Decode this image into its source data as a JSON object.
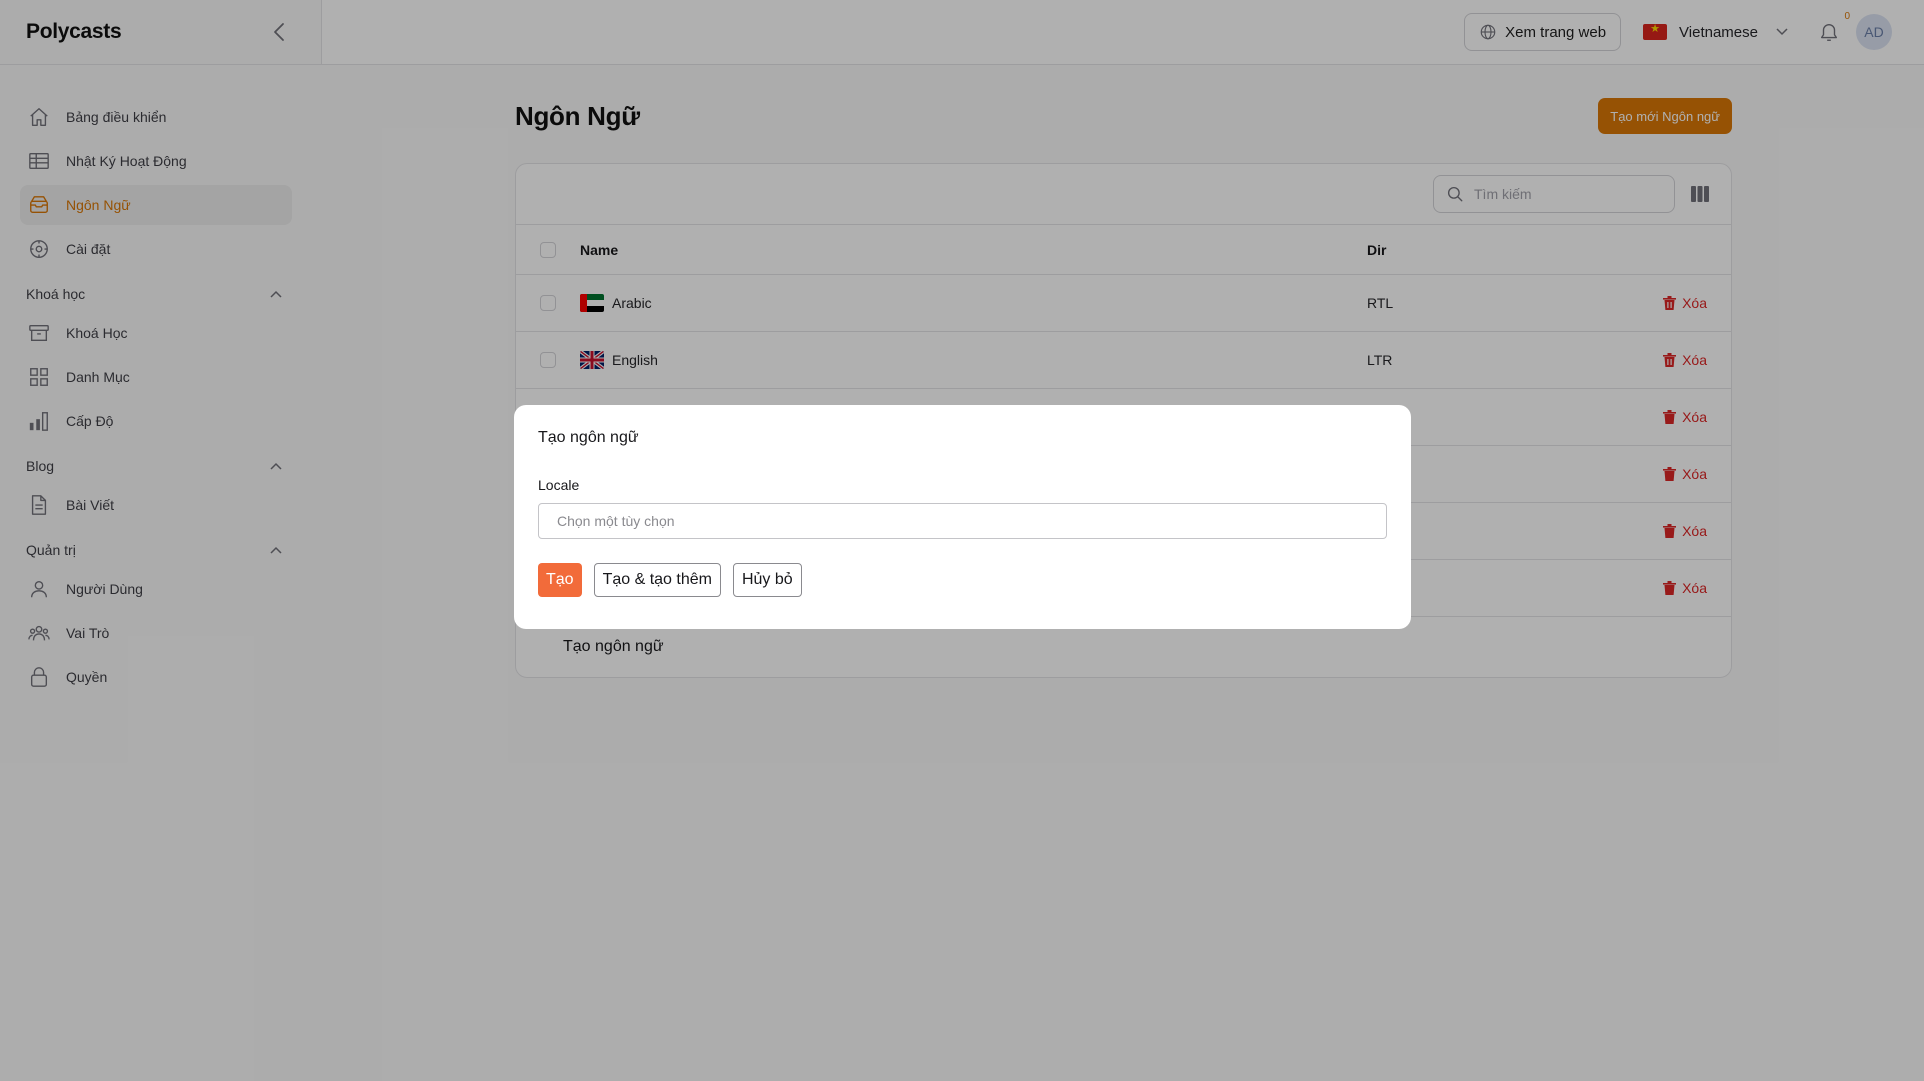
{
  "app": {
    "brand": "Polycasts"
  },
  "topbar": {
    "view_site_label": "Xem trang web",
    "language_label": "Vietnamese",
    "notification_count": "0",
    "avatar_initials": "AD"
  },
  "sidebar": {
    "items": [
      {
        "label": "Bảng điều khiển",
        "icon": "home-icon"
      },
      {
        "label": "Nhật Ký Hoạt Động",
        "icon": "table-icon"
      },
      {
        "label": "Ngôn Ngữ",
        "icon": "inbox-icon",
        "active": true
      },
      {
        "label": "Cài đặt",
        "icon": "settings-icon"
      }
    ],
    "groups": [
      {
        "label": "Khoá học",
        "items": [
          {
            "label": "Khoá Học",
            "icon": "archive-icon"
          },
          {
            "label": "Danh Mục",
            "icon": "grid-icon"
          },
          {
            "label": "Cấp Độ",
            "icon": "bar-chart-icon"
          }
        ]
      },
      {
        "label": "Blog",
        "items": [
          {
            "label": "Bài Viết",
            "icon": "document-icon"
          }
        ]
      },
      {
        "label": "Quản trị",
        "items": [
          {
            "label": "Người Dùng",
            "icon": "user-icon"
          },
          {
            "label": "Vai Trò",
            "icon": "users-icon"
          },
          {
            "label": "Quyền",
            "icon": "lock-icon"
          }
        ]
      }
    ]
  },
  "page": {
    "title": "Ngôn Ngữ",
    "create_button": "Tạo mới Ngôn ngữ",
    "search_placeholder": "Tìm kiếm"
  },
  "table": {
    "columns": [
      "Name",
      "Dir"
    ],
    "delete_label": "Xóa",
    "rows": [
      {
        "name": "Arabic",
        "dir": "RTL",
        "flag": "ae"
      },
      {
        "name": "English",
        "dir": "LTR",
        "flag": "gb"
      }
    ],
    "footer_text": "Tạo ngôn ngữ"
  },
  "modal": {
    "title": "Tạo ngôn ngữ",
    "field_label": "Locale",
    "select_placeholder": "Chọn một tùy chọn",
    "btn_create": "Tạo",
    "btn_create_another": "Tạo & tạo thêm",
    "btn_cancel": "Hủy bỏ"
  },
  "colors": {
    "accent": "#d97706",
    "danger": "#dc2626",
    "modal_primary": "#f26b3a"
  }
}
